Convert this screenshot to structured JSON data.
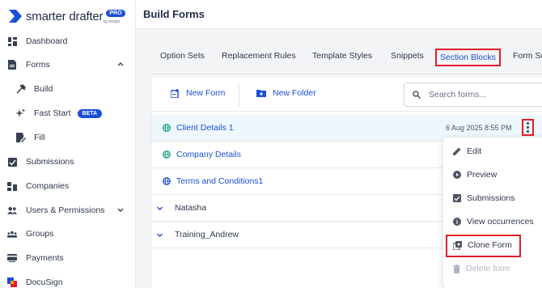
{
  "brand": {
    "name": "smarter drafter",
    "badge": "PRO",
    "byline": "by tenais"
  },
  "sidebar": {
    "items": [
      {
        "label": "Dashboard",
        "icon": "dashboard-icon"
      },
      {
        "label": "Forms",
        "icon": "forms-icon",
        "expanded": true
      },
      {
        "label": "Build",
        "icon": "build-icon"
      },
      {
        "label": "Fast Start",
        "icon": "sparkle-icon",
        "badge": "BETA"
      },
      {
        "label": "Fill",
        "icon": "fill-icon"
      },
      {
        "label": "Submissions",
        "icon": "submissions-icon"
      },
      {
        "label": "Companies",
        "icon": "companies-icon"
      },
      {
        "label": "Users & Permissions",
        "icon": "users-icon",
        "expanded": false
      },
      {
        "label": "Groups",
        "icon": "groups-icon"
      },
      {
        "label": "Payments",
        "icon": "payments-icon"
      },
      {
        "label": "DocuSign",
        "icon": "docusign-icon"
      }
    ]
  },
  "header": {
    "title": "Build Forms"
  },
  "tabs": [
    {
      "label": "Option Sets"
    },
    {
      "label": "Replacement Rules"
    },
    {
      "label": "Template Styles"
    },
    {
      "label": "Snippets"
    },
    {
      "label": "Section Blocks",
      "active": true
    },
    {
      "label": "Form Se"
    }
  ],
  "toolbar": {
    "new_form": "New Form",
    "new_folder": "New Folder",
    "search_placeholder": "Search forms..."
  },
  "rows": [
    {
      "name": "Client Details 1",
      "type": "form",
      "date": "6 Aug 2025 8:55 PM",
      "selected": true
    },
    {
      "name": "Company Details",
      "type": "form"
    },
    {
      "name": "Terms and Conditions1",
      "type": "form"
    },
    {
      "name": "Natasha",
      "type": "folder"
    },
    {
      "name": "Training_Andrew",
      "type": "folder"
    }
  ],
  "menu": {
    "items": [
      {
        "label": "Edit",
        "icon": "pencil-icon"
      },
      {
        "label": "Preview",
        "icon": "play-icon"
      },
      {
        "label": "Submissions",
        "icon": "submissions-icon"
      },
      {
        "label": "View occurrences",
        "icon": "info-icon"
      },
      {
        "label": "Clone Form",
        "icon": "clone-icon",
        "highlighted": true
      },
      {
        "label": "Delete form",
        "icon": "trash-icon",
        "disabled": true
      }
    ]
  },
  "colors": {
    "accent": "#1b4fd8",
    "highlight": "#e11d2a",
    "selected_row": "#eef7fb"
  }
}
